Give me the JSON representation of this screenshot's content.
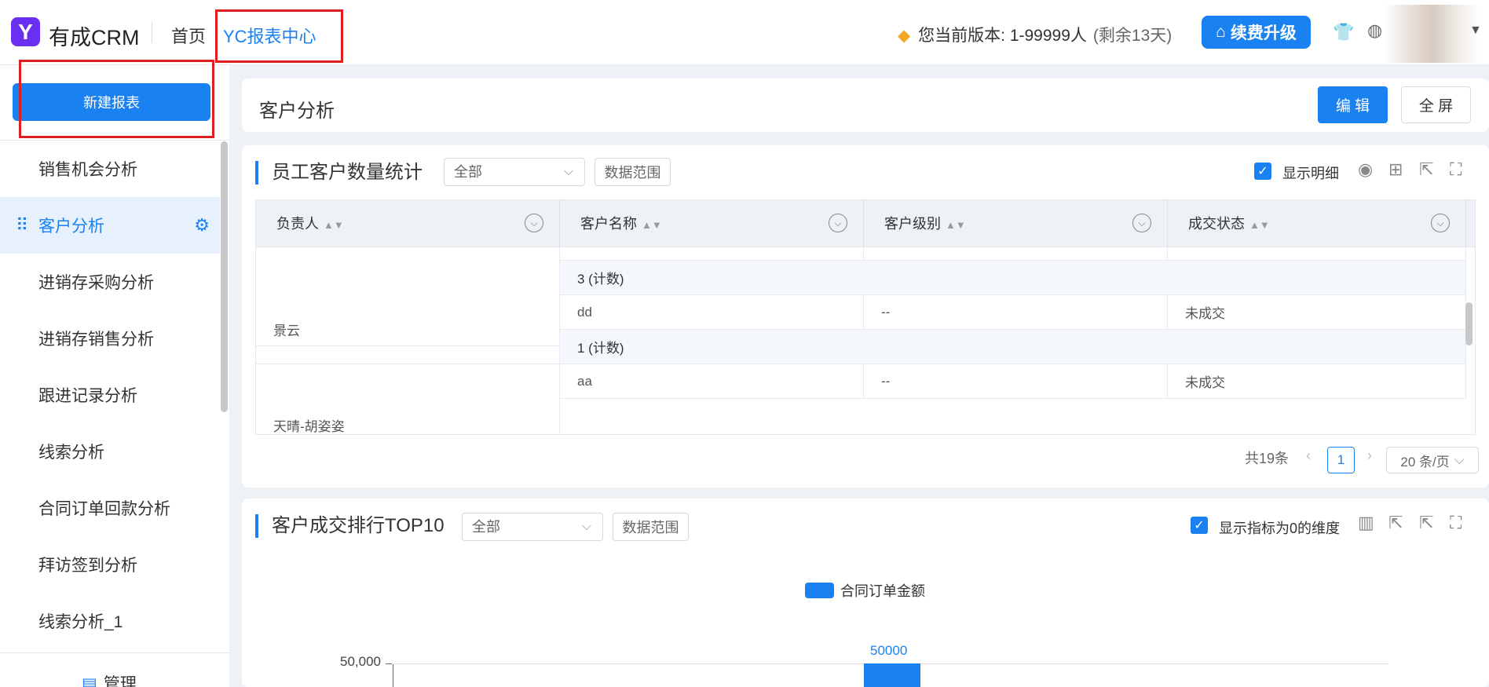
{
  "header": {
    "app_name": "有成CRM",
    "logo_letter": "Y",
    "nav_home": "首页",
    "nav_report": "YC报表中心",
    "version_text": "您当前版本: 1-99999人",
    "remaining": "(剩余13天)",
    "upgrade_label": "续费升级"
  },
  "sidebar": {
    "new_report": "新建报表",
    "items": [
      {
        "label": "销售机会分析"
      },
      {
        "label": "客户分析"
      },
      {
        "label": "进销存采购分析"
      },
      {
        "label": "进销存销售分析"
      },
      {
        "label": "跟进记录分析"
      },
      {
        "label": "线索分析"
      },
      {
        "label": "合同订单回款分析"
      },
      {
        "label": "拜访签到分析"
      },
      {
        "label": "线索分析_1"
      }
    ],
    "active_index": 1,
    "manage_label": "管理"
  },
  "page": {
    "title": "客户分析",
    "edit_label": "编 辑",
    "fullscreen_label": "全 屏"
  },
  "widget1": {
    "title": "员工客户数量统计",
    "filter_value": "全部",
    "range_label": "数据范围",
    "show_detail_label": "显示明细",
    "columns": [
      "负责人",
      "客户名称",
      "客户级别",
      "成交状态"
    ],
    "rows": {
      "count_a": "3 (计数)",
      "owner_b": "景云",
      "b_name": "dd",
      "b_level": "--",
      "b_status": "未成交",
      "count_b": "1 (计数)",
      "owner_c": "天晴-胡姿姿",
      "c_name": "aa",
      "c_level": "--",
      "c_status": "未成交"
    },
    "total": "共19条",
    "page": "1",
    "page_size": "20 条/页"
  },
  "widget2": {
    "title": "客户成交排行TOP10",
    "filter_value": "全部",
    "range_label": "数据范围",
    "show_zero_label": "显示指标为0的维度"
  },
  "chart_data": {
    "type": "bar",
    "title": "",
    "series": [
      {
        "name": "合同订单金额",
        "values": [
          50000
        ]
      }
    ],
    "categories": [
      ""
    ],
    "y_ticks": [
      "50,000"
    ],
    "data_labels": [
      "50000"
    ],
    "colors": {
      "series": "#1a82f0"
    }
  },
  "colors": {
    "accent": "#1a82f0",
    "logo": "#6a2ff0",
    "highlight_box": "#e02020"
  }
}
